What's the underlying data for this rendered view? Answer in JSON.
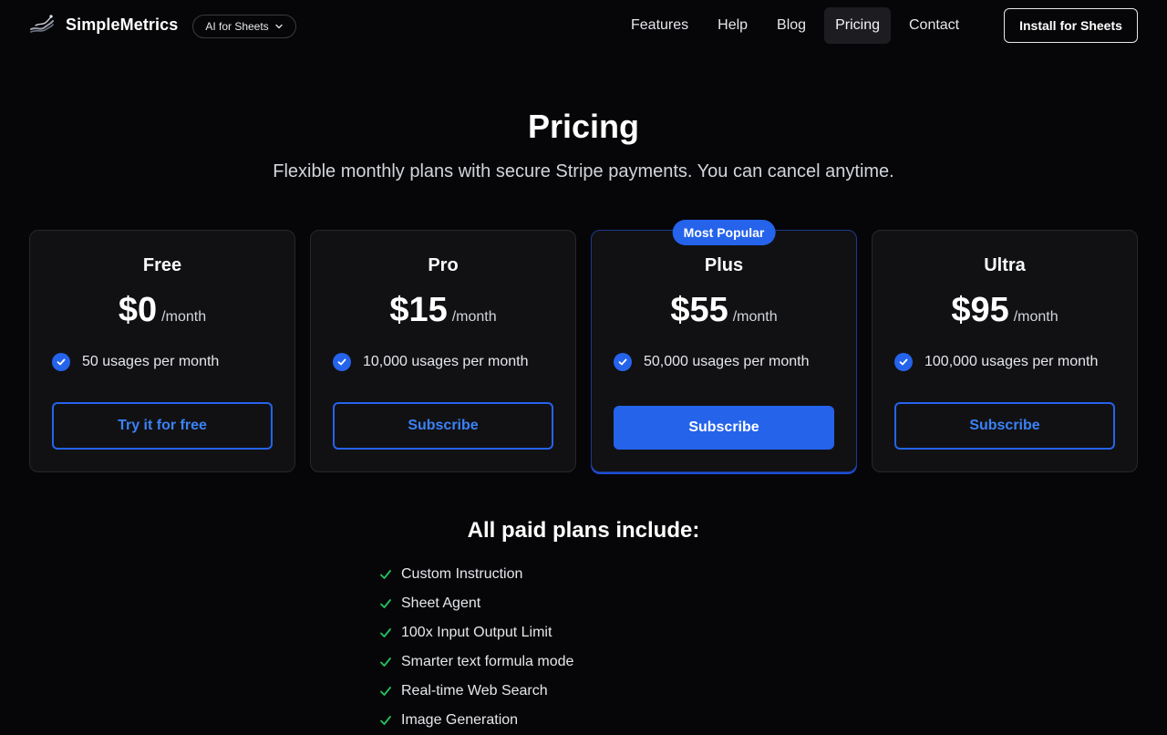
{
  "header": {
    "brand_name": "SimpleMetrics",
    "product_dropdown": "AI for Sheets",
    "nav": [
      {
        "label": "Features",
        "active": false
      },
      {
        "label": "Help",
        "active": false
      },
      {
        "label": "Blog",
        "active": false
      },
      {
        "label": "Pricing",
        "active": true
      },
      {
        "label": "Contact",
        "active": false
      }
    ],
    "install_button": "Install for Sheets"
  },
  "hero": {
    "title": "Pricing",
    "subtitle": "Flexible monthly plans with secure Stripe payments. You can cancel anytime."
  },
  "plans": [
    {
      "name": "Free",
      "price": "$0",
      "period": "/month",
      "feature": "50 usages per month",
      "button": "Try it for free",
      "popular": false
    },
    {
      "name": "Pro",
      "price": "$15",
      "period": "/month",
      "feature": "10,000 usages per month",
      "button": "Subscribe",
      "popular": false
    },
    {
      "name": "Plus",
      "price": "$55",
      "period": "/month",
      "feature": "50,000 usages per month",
      "button": "Subscribe",
      "popular": true,
      "badge": "Most Popular"
    },
    {
      "name": "Ultra",
      "price": "$95",
      "period": "/month",
      "feature": "100,000 usages per month",
      "button": "Subscribe",
      "popular": false
    }
  ],
  "included": {
    "title": "All paid plans include:",
    "items": [
      "Custom Instruction",
      "Sheet Agent",
      "100x Input Output Limit",
      "Smarter text formula mode",
      "Real-time Web Search",
      "Image Generation"
    ]
  },
  "colors": {
    "background": "#060608",
    "accent": "#2563eb",
    "check_green": "#22c55e"
  },
  "icons": {
    "logo": "wave-logo-icon",
    "dropdown": "chevron-down-icon",
    "plan_feature": "check-circle-icon",
    "included_feature": "check-icon"
  }
}
